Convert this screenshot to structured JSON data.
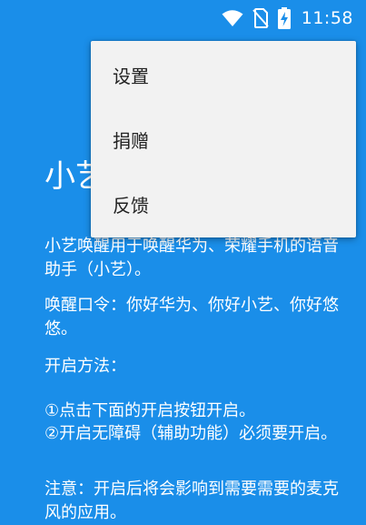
{
  "status_bar": {
    "time": "11:58",
    "icons": [
      "wifi-icon",
      "no-sim-icon",
      "battery-charging-icon"
    ]
  },
  "app": {
    "title": "小艺唤醒"
  },
  "menu": {
    "items": [
      {
        "label": "设置"
      },
      {
        "label": "捐赠"
      },
      {
        "label": "反馈"
      }
    ]
  },
  "content": {
    "intro": "小艺唤醒用于唤醒华为、荣耀手机的语音助手（小艺）。",
    "wake_command": "唤醒口令：你好华为、你好小艺、你好悠悠。",
    "method_title": "开启方法：",
    "step1": "①点击下面的开启按钮开启。",
    "step2": "②开启无障碍（辅助功能）必须要开启。",
    "note": "注意：开启后将会影响到需要需要的麦克风的应用。"
  },
  "colors": {
    "background": "#1a8ee9",
    "menu_background": "#f2f2f2",
    "menu_text": "#222222"
  }
}
